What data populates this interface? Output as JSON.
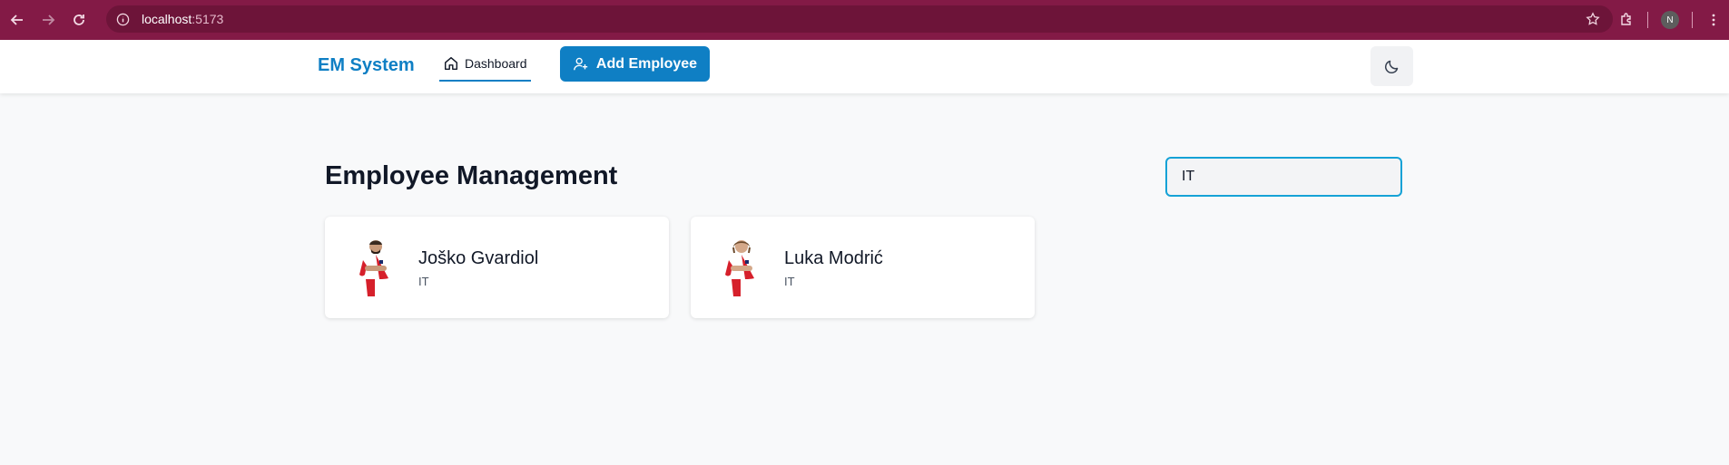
{
  "browser": {
    "url_host": "localhost",
    "url_port": ":5173",
    "profile_initial": "N"
  },
  "header": {
    "brand": "EM System",
    "nav_dashboard": "Dashboard",
    "add_employee": "Add Employee"
  },
  "main": {
    "title": "Employee Management",
    "search_value": "IT"
  },
  "employees": [
    {
      "name": "Joško Gvardiol",
      "department": "IT"
    },
    {
      "name": "Luka Modrić",
      "department": "IT"
    }
  ],
  "colors": {
    "browser_bar": "#831a46",
    "accent": "#0f7fc4",
    "search_border": "#15a2d6"
  }
}
